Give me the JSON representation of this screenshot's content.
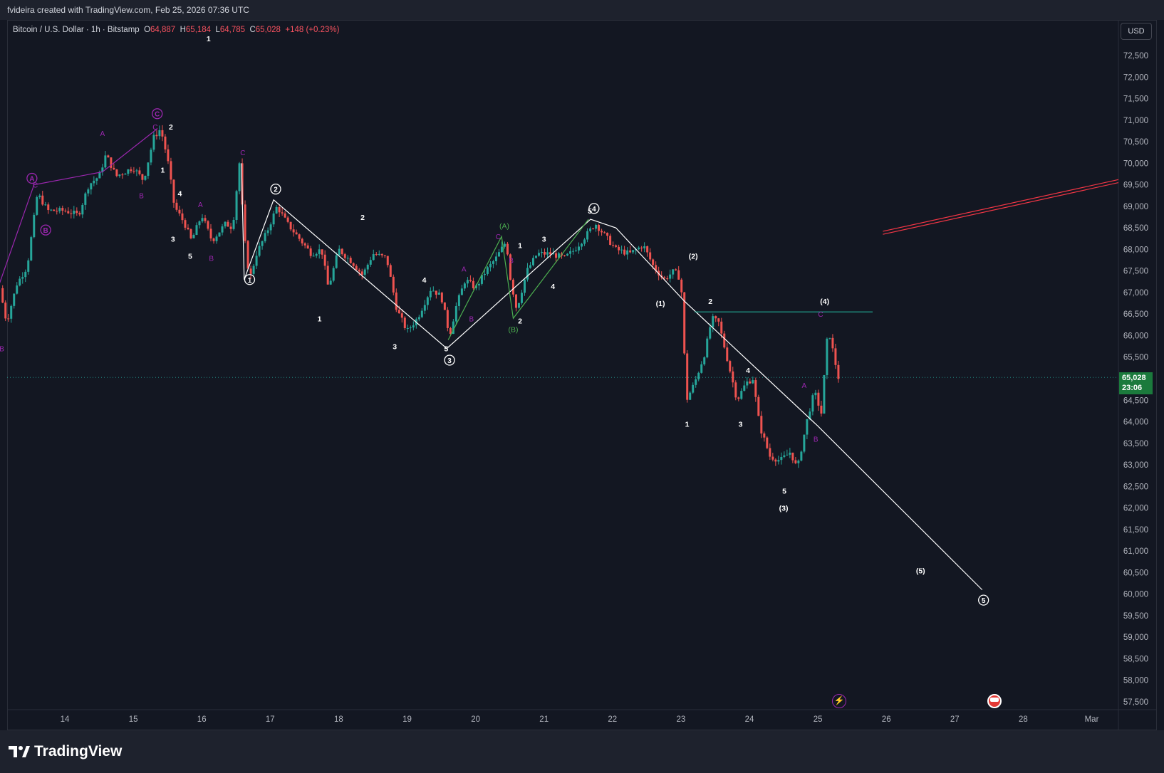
{
  "header": {
    "attribution": "fvideira created with TradingView.com, Feb 25, 2026 07:36 UTC"
  },
  "symbol": {
    "name": "Bitcoin / U.S. Dollar · 1h · Bitstamp",
    "open_label": "O",
    "open": "64,887",
    "high_label": "H",
    "high": "65,184",
    "low_label": "L",
    "low": "64,785",
    "close_label": "C",
    "close": "65,028",
    "change": "+148 (+0.23%)"
  },
  "currency_button": "USD",
  "last_price": {
    "price": "65,028",
    "countdown": "23:06"
  },
  "brand": {
    "name": "TradingView"
  },
  "colors": {
    "background": "#131722",
    "up": "#26a69a",
    "down": "#ef5350",
    "wave_white": "#ffffff",
    "wave_purple": "#9c27b0",
    "wave_green": "#4caf50",
    "trendline_red": "#f23645",
    "level_teal": "#22ab94"
  },
  "chart_data": {
    "type": "candlestick",
    "timeframe": "1h",
    "y_ticks": [
      "72,500",
      "72,000",
      "71,500",
      "71,000",
      "70,500",
      "70,000",
      "69,500",
      "69,000",
      "68,500",
      "68,000",
      "67,500",
      "67,000",
      "66,500",
      "66,000",
      "65,500",
      "65,000",
      "64,500",
      "64,000",
      "63,500",
      "63,000",
      "62,500",
      "62,000",
      "61,500",
      "61,000",
      "60,500",
      "60,000",
      "59,500",
      "59,000",
      "58,500",
      "58,000",
      "57,500"
    ],
    "x_ticks": [
      "14",
      "15",
      "16",
      "17",
      "18",
      "19",
      "20",
      "21",
      "22",
      "23",
      "24",
      "25",
      "26",
      "27",
      "28",
      "Mar"
    ],
    "ylim": [
      57300,
      72900
    ],
    "price_path": [
      {
        "t": 13.05,
        "p": 67100
      },
      {
        "t": 13.15,
        "p": 66300
      },
      {
        "t": 13.3,
        "p": 67200
      },
      {
        "t": 13.45,
        "p": 67600
      },
      {
        "t": 13.6,
        "p": 69300
      },
      {
        "t": 13.75,
        "p": 68900
      },
      {
        "t": 14.0,
        "p": 68900
      },
      {
        "t": 14.2,
        "p": 68800
      },
      {
        "t": 14.35,
        "p": 69500
      },
      {
        "t": 14.5,
        "p": 69700
      },
      {
        "t": 14.6,
        "p": 70200
      },
      {
        "t": 14.75,
        "p": 69700
      },
      {
        "t": 15.0,
        "p": 69900
      },
      {
        "t": 15.15,
        "p": 69600
      },
      {
        "t": 15.3,
        "p": 70600
      },
      {
        "t": 15.4,
        "p": 70800
      },
      {
        "t": 15.5,
        "p": 70100
      },
      {
        "t": 15.6,
        "p": 69000
      },
      {
        "t": 15.75,
        "p": 68600
      },
      {
        "t": 15.85,
        "p": 68200
      },
      {
        "t": 16.0,
        "p": 68800
      },
      {
        "t": 16.15,
        "p": 68200
      },
      {
        "t": 16.35,
        "p": 68600
      },
      {
        "t": 16.45,
        "p": 68500
      },
      {
        "t": 16.55,
        "p": 70000
      },
      {
        "t": 16.62,
        "p": 68300
      },
      {
        "t": 16.7,
        "p": 67300
      },
      {
        "t": 16.8,
        "p": 67900
      },
      {
        "t": 16.95,
        "p": 68400
      },
      {
        "t": 17.1,
        "p": 69000
      },
      {
        "t": 17.25,
        "p": 68600
      },
      {
        "t": 17.45,
        "p": 68200
      },
      {
        "t": 17.6,
        "p": 67900
      },
      {
        "t": 17.75,
        "p": 68000
      },
      {
        "t": 17.85,
        "p": 67100
      },
      {
        "t": 18.0,
        "p": 68000
      },
      {
        "t": 18.2,
        "p": 67700
      },
      {
        "t": 18.35,
        "p": 67400
      },
      {
        "t": 18.5,
        "p": 67900
      },
      {
        "t": 18.7,
        "p": 67800
      },
      {
        "t": 18.85,
        "p": 66600
      },
      {
        "t": 19.0,
        "p": 66100
      },
      {
        "t": 19.15,
        "p": 66400
      },
      {
        "t": 19.35,
        "p": 67100
      },
      {
        "t": 19.5,
        "p": 66900
      },
      {
        "t": 19.62,
        "p": 66000
      },
      {
        "t": 19.72,
        "p": 66700
      },
      {
        "t": 19.85,
        "p": 67300
      },
      {
        "t": 20.0,
        "p": 67100
      },
      {
        "t": 20.15,
        "p": 67500
      },
      {
        "t": 20.3,
        "p": 67800
      },
      {
        "t": 20.45,
        "p": 68200
      },
      {
        "t": 20.5,
        "p": 67400
      },
      {
        "t": 20.6,
        "p": 66600
      },
      {
        "t": 20.75,
        "p": 67500
      },
      {
        "t": 20.9,
        "p": 67900
      },
      {
        "t": 21.1,
        "p": 67900
      },
      {
        "t": 21.3,
        "p": 67800
      },
      {
        "t": 21.45,
        "p": 68000
      },
      {
        "t": 21.6,
        "p": 68300
      },
      {
        "t": 21.75,
        "p": 68600
      },
      {
        "t": 21.9,
        "p": 68300
      },
      {
        "t": 22.05,
        "p": 68000
      },
      {
        "t": 22.25,
        "p": 67900
      },
      {
        "t": 22.45,
        "p": 68100
      },
      {
        "t": 22.6,
        "p": 67600
      },
      {
        "t": 22.75,
        "p": 67300
      },
      {
        "t": 22.9,
        "p": 67500
      },
      {
        "t": 23.0,
        "p": 67300
      },
      {
        "t": 23.08,
        "p": 64500
      },
      {
        "t": 23.2,
        "p": 64900
      },
      {
        "t": 23.35,
        "p": 65600
      },
      {
        "t": 23.45,
        "p": 66400
      },
      {
        "t": 23.55,
        "p": 66300
      },
      {
        "t": 23.7,
        "p": 65300
      },
      {
        "t": 23.82,
        "p": 64500
      },
      {
        "t": 23.95,
        "p": 64900
      },
      {
        "t": 24.05,
        "p": 65000
      },
      {
        "t": 24.15,
        "p": 63900
      },
      {
        "t": 24.3,
        "p": 63200
      },
      {
        "t": 24.45,
        "p": 63100
      },
      {
        "t": 24.6,
        "p": 63300
      },
      {
        "t": 24.7,
        "p": 62900
      },
      {
        "t": 24.85,
        "p": 64100
      },
      {
        "t": 24.95,
        "p": 64700
      },
      {
        "t": 25.05,
        "p": 64200
      },
      {
        "t": 25.15,
        "p": 66200
      },
      {
        "t": 25.25,
        "p": 65400
      },
      {
        "t": 25.3,
        "p": 65028
      }
    ],
    "wave_lines": [
      {
        "color": "white",
        "points": [
          [
            16.62,
            67300
          ],
          [
            17.05,
            69150
          ],
          [
            19.58,
            65700
          ],
          [
            21.68,
            68700
          ],
          [
            22.05,
            68500
          ],
          [
            23.05,
            66800
          ],
          [
            25.0,
            63900
          ],
          [
            27.4,
            60100
          ]
        ]
      },
      {
        "color": "purple",
        "points": [
          [
            13.0,
            67000
          ],
          [
            13.55,
            69500
          ],
          [
            14.55,
            69800
          ],
          [
            15.35,
            70800
          ]
        ]
      },
      {
        "color": "green",
        "points": [
          [
            19.6,
            65900
          ],
          [
            20.38,
            68300
          ],
          [
            20.55,
            66400
          ],
          [
            21.65,
            68700
          ]
        ]
      },
      {
        "color": "white",
        "points": [
          [
            16.62,
            67300
          ],
          [
            16.58,
            70000
          ]
        ]
      }
    ],
    "red_trendlines": [
      {
        "points": [
          [
            25.95,
            68350
          ],
          [
            29.4,
            69550
          ]
        ]
      },
      {
        "points": [
          [
            25.95,
            68420
          ],
          [
            29.4,
            69620
          ]
        ]
      }
    ],
    "resistance_level": {
      "price": 66550,
      "t_start": 23.2,
      "t_end": 25.8
    },
    "labels": [
      {
        "text": "1",
        "t": 16.7,
        "p": 67300,
        "style": "circle-white"
      },
      {
        "text": "2",
        "t": 17.08,
        "p": 69400,
        "style": "circle-white"
      },
      {
        "text": "3",
        "t": 19.62,
        "p": 65430,
        "style": "circle-white"
      },
      {
        "text": "4",
        "t": 21.73,
        "p": 68950,
        "style": "circle-white"
      },
      {
        "text": "5",
        "t": 27.42,
        "p": 59860,
        "style": "circle-white"
      },
      {
        "text": "A",
        "t": 13.52,
        "p": 69650,
        "style": "circle-purple"
      },
      {
        "text": "B",
        "t": 13.72,
        "p": 68450,
        "style": "circle-purple"
      },
      {
        "text": "C",
        "t": 15.35,
        "p": 71150,
        "style": "circle-purple"
      },
      {
        "text": "(1)",
        "t": 22.7,
        "p": 66750,
        "style": "bold-white"
      },
      {
        "text": "(2)",
        "t": 23.18,
        "p": 67850,
        "style": "bold-white"
      },
      {
        "text": "(3)",
        "t": 24.5,
        "p": 62000,
        "style": "bold-white"
      },
      {
        "text": "(4)",
        "t": 25.1,
        "p": 66800,
        "style": "bold-white"
      },
      {
        "text": "(5)",
        "t": 26.5,
        "p": 60550,
        "style": "bold-white"
      },
      {
        "text": "(A)",
        "t": 20.42,
        "p": 68550,
        "style": "green"
      },
      {
        "text": "(B)",
        "t": 20.55,
        "p": 66150,
        "style": "green"
      },
      {
        "text": "1",
        "t": 16.1,
        "p": 72900,
        "style": "bold-white"
      },
      {
        "text": "2",
        "t": 15.55,
        "p": 70850,
        "style": "bold-white"
      },
      {
        "text": "1",
        "t": 15.43,
        "p": 69850,
        "style": "bold-white"
      },
      {
        "text": "4",
        "t": 15.68,
        "p": 69300,
        "style": "bold-white"
      },
      {
        "text": "3",
        "t": 15.58,
        "p": 68250,
        "style": "bold-white"
      },
      {
        "text": "5",
        "t": 15.83,
        "p": 67850,
        "style": "bold-white"
      },
      {
        "text": "2",
        "t": 18.35,
        "p": 68750,
        "style": "bold-white"
      },
      {
        "text": "1",
        "t": 17.72,
        "p": 66400,
        "style": "bold-white"
      },
      {
        "text": "4",
        "t": 19.25,
        "p": 67300,
        "style": "bold-white"
      },
      {
        "text": "3",
        "t": 18.82,
        "p": 65750,
        "style": "bold-white"
      },
      {
        "text": "5",
        "t": 19.57,
        "p": 65700,
        "style": "bold-white"
      },
      {
        "text": "1",
        "t": 20.65,
        "p": 68100,
        "style": "bold-white"
      },
      {
        "text": "3",
        "t": 21.0,
        "p": 68250,
        "style": "bold-white"
      },
      {
        "text": "4",
        "t": 21.13,
        "p": 67150,
        "style": "bold-white"
      },
      {
        "text": "2",
        "t": 20.65,
        "p": 66350,
        "style": "bold-white"
      },
      {
        "text": "5",
        "t": 21.67,
        "p": 68900,
        "style": "bold-white"
      },
      {
        "text": "2",
        "t": 23.43,
        "p": 66800,
        "style": "bold-white"
      },
      {
        "text": "1",
        "t": 23.09,
        "p": 63950,
        "style": "bold-white"
      },
      {
        "text": "4",
        "t": 23.98,
        "p": 65200,
        "style": "bold-white"
      },
      {
        "text": "3",
        "t": 23.87,
        "p": 63950,
        "style": "bold-white"
      },
      {
        "text": "5",
        "t": 24.51,
        "p": 62400,
        "style": "bold-white"
      },
      {
        "text": "A",
        "t": 14.55,
        "p": 70700,
        "style": "purple"
      },
      {
        "text": "B",
        "t": 15.12,
        "p": 69250,
        "style": "purple"
      },
      {
        "text": "C",
        "t": 15.32,
        "p": 70850,
        "style": "purple"
      },
      {
        "text": "C",
        "t": 13.57,
        "p": 69500,
        "style": "purple"
      },
      {
        "text": "B",
        "t": 13.08,
        "p": 65700,
        "style": "purple"
      },
      {
        "text": "A",
        "t": 15.98,
        "p": 69050,
        "style": "purple"
      },
      {
        "text": "B",
        "t": 16.14,
        "p": 67800,
        "style": "purple"
      },
      {
        "text": "C",
        "t": 16.6,
        "p": 70250,
        "style": "purple"
      },
      {
        "text": "A",
        "t": 19.83,
        "p": 67550,
        "style": "purple"
      },
      {
        "text": "B",
        "t": 19.94,
        "p": 66400,
        "style": "purple"
      },
      {
        "text": "C",
        "t": 20.33,
        "p": 68300,
        "style": "purple"
      },
      {
        "text": "B",
        "t": 20.52,
        "p": 67750,
        "style": "purple"
      },
      {
        "text": "A",
        "t": 24.8,
        "p": 64850,
        "style": "purple"
      },
      {
        "text": "B",
        "t": 24.97,
        "p": 63600,
        "style": "purple"
      },
      {
        "text": "C",
        "t": 25.04,
        "p": 66500,
        "style": "purple"
      }
    ]
  }
}
